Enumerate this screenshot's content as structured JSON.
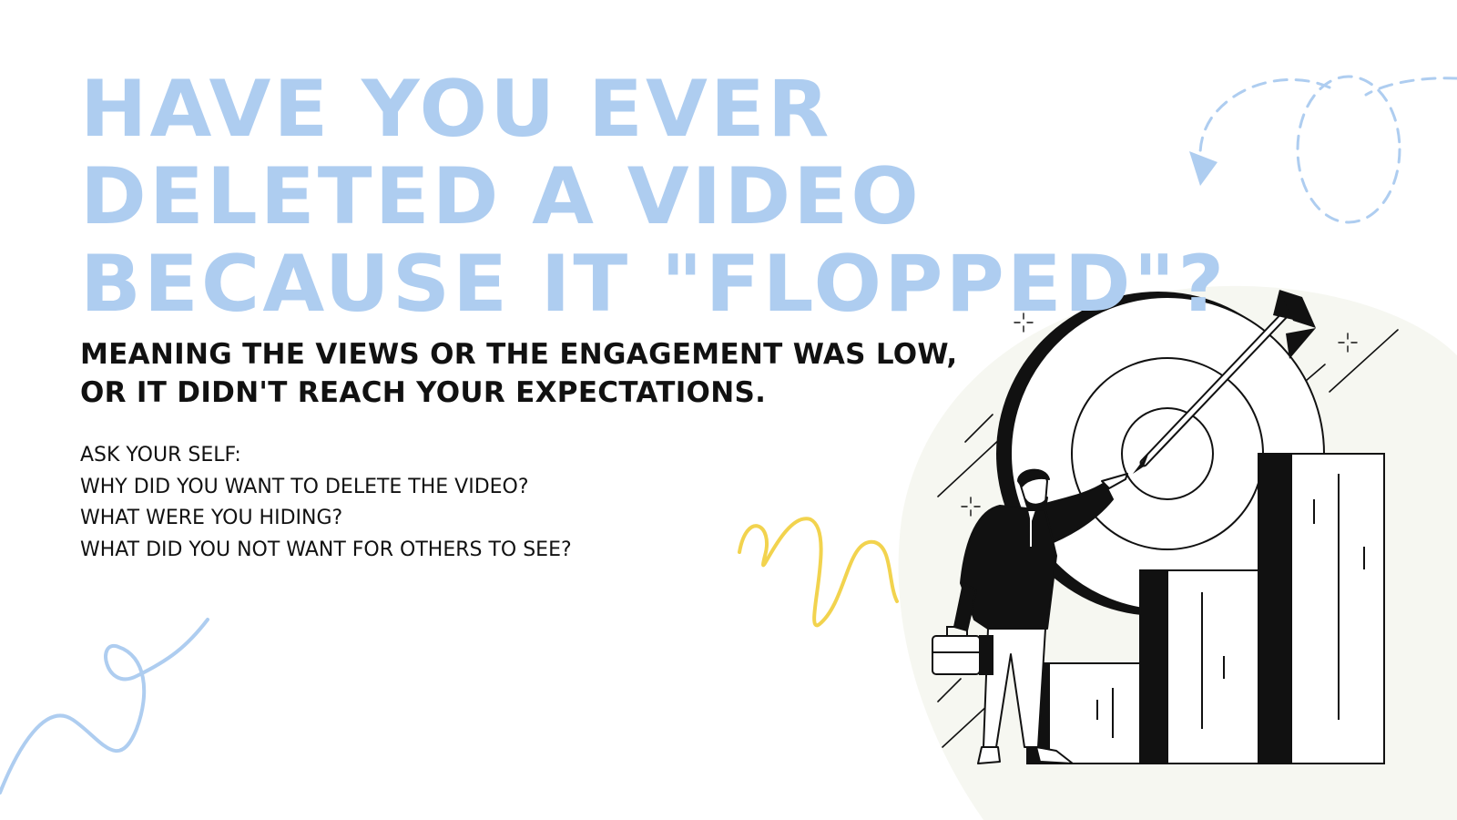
{
  "headline": {
    "lines": [
      "HAVE YOU EVER",
      "DELETED A VIDEO",
      "BECAUSE IT \"FLOPPED\"?"
    ]
  },
  "subheadline": {
    "lines": [
      "MEANING THE VIEWS OR THE ENGAGEMENT WAS LOW,",
      "OR IT DIDN'T REACH YOUR EXPECTATIONS."
    ]
  },
  "questions": {
    "items": [
      "ASK YOUR SELF:",
      "WHY DID YOU WANT TO DELETE THE VIDEO?",
      "WHAT WERE YOU HIDING?",
      "WHAT DID YOU NOT WANT FOR OTHERS TO SEE?"
    ]
  },
  "colors": {
    "headline": "#aecdf0",
    "text": "#111111",
    "accent_yellow": "#f2d34e",
    "accent_blue": "#aecdf0",
    "blob": "#f6f7f1"
  },
  "illustration": {
    "icons": [
      "target-icon",
      "arrow-icon",
      "businessman-icon",
      "briefcase-icon",
      "bar-chart-icon"
    ]
  }
}
